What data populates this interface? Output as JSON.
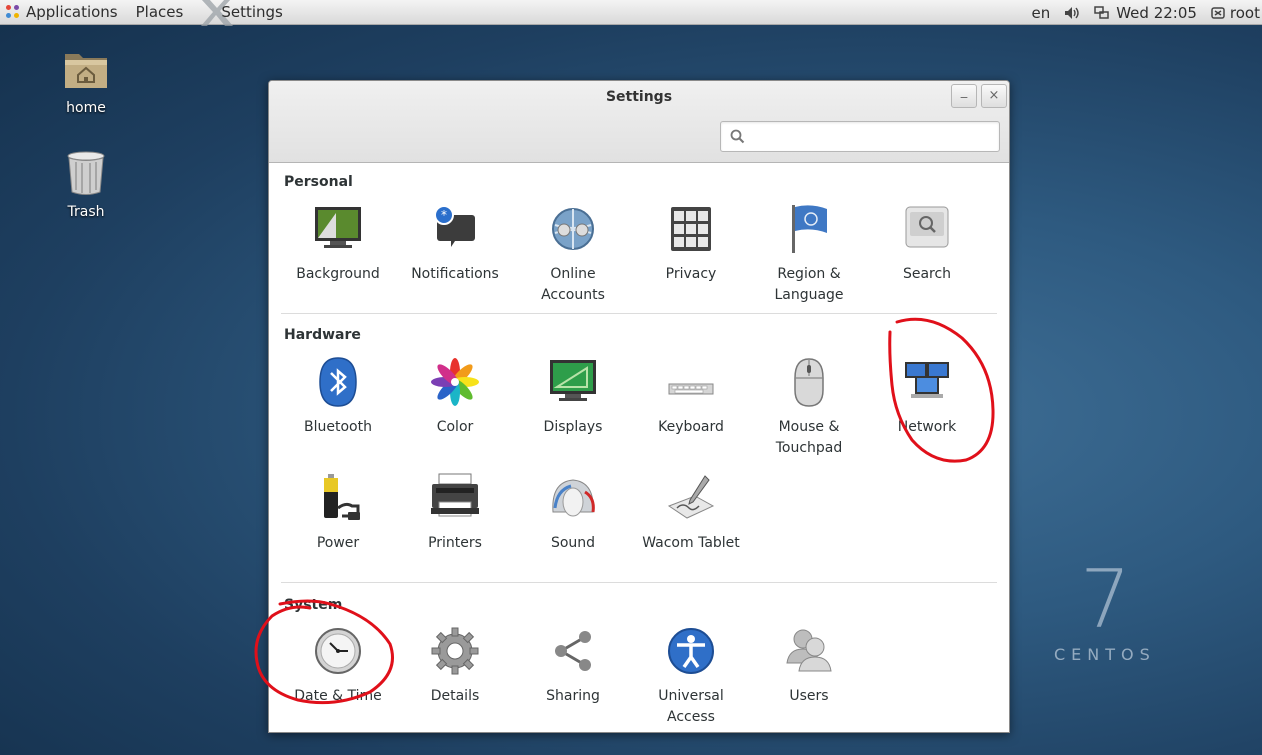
{
  "topbar": {
    "applications": "Applications",
    "places": "Places",
    "settings": "Settings",
    "lang": "en",
    "clock": "Wed 22:05",
    "user": "root"
  },
  "desktop": {
    "home": "home",
    "trash": "Trash",
    "brand_number": "7",
    "brand_text": "CENTOS"
  },
  "window": {
    "title": "Settings",
    "minimize": "_",
    "close": "×",
    "search_placeholder": ""
  },
  "sections": [
    {
      "title": "Personal",
      "items": [
        "Background",
        "Notifications",
        "Online Accounts",
        "Privacy",
        "Region & Language",
        "Search"
      ]
    },
    {
      "title": "Hardware",
      "items": [
        "Bluetooth",
        "Color",
        "Displays",
        "Keyboard",
        "Mouse & Touchpad",
        "Network",
        "Power",
        "Printers",
        "Sound",
        "Wacom Tablet"
      ]
    },
    {
      "title": "System",
      "items": [
        "Date & Time",
        "Details",
        "Sharing",
        "Universal Access",
        "Users"
      ]
    }
  ],
  "labels": {
    "background": "Background",
    "notifications": "Notifications",
    "online_accounts_1": "Online",
    "online_accounts_2": "Accounts",
    "privacy": "Privacy",
    "region_1": "Region &",
    "region_2": "Language",
    "search": "Search",
    "bluetooth": "Bluetooth",
    "color": "Color",
    "displays": "Displays",
    "keyboard": "Keyboard",
    "mouse_1": "Mouse &",
    "mouse_2": "Touchpad",
    "network": "Network",
    "power": "Power",
    "printers": "Printers",
    "sound": "Sound",
    "wacom": "Wacom Tablet",
    "datetime": "Date & Time",
    "details": "Details",
    "sharing": "Sharing",
    "universal_1": "Universal",
    "universal_2": "Access",
    "users": "Users"
  },
  "colors": {
    "annotation": "#e0101a",
    "desktop_bg": "#2e5a80"
  }
}
